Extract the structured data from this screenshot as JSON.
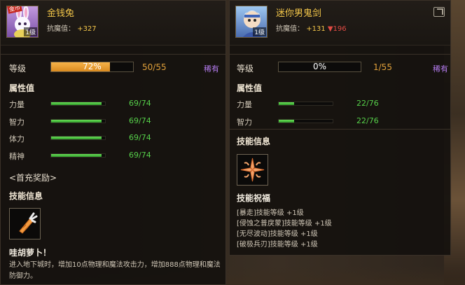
{
  "left": {
    "name": "金钱兔",
    "badge": "金币",
    "level_badge": "1级",
    "resist_label": "抗魔值：",
    "resist_plus": "+327",
    "level_label": "等级",
    "level_percent": "72%",
    "level_fill": 0.72,
    "level_count": "50/55",
    "rarity": "稀有",
    "attrs_title": "属性值",
    "attrs": [
      {
        "name": "力量",
        "value": "69/74",
        "ratio": 0.93
      },
      {
        "name": "智力",
        "value": "69/74",
        "ratio": 0.93
      },
      {
        "name": "体力",
        "value": "69/74",
        "ratio": 0.93
      },
      {
        "name": "精神",
        "value": "69/74",
        "ratio": 0.93
      }
    ],
    "first_charge": "<首充奖励>",
    "skills_title": "技能信息",
    "skill_name": "哇胡萝卜！",
    "skill_desc": "进入地下城时，增加10点物理和魔法攻击力，增加888点物理和魔法防御力。"
  },
  "right": {
    "name": "迷你男鬼剑",
    "level_badge": "1级",
    "resist_label": "抗魔值：",
    "resist_plus": "+131",
    "resist_down": "▼196",
    "level_label": "等级",
    "level_percent": "0%",
    "level_fill": 0.0,
    "level_count": "1/55",
    "rarity": "稀有",
    "attrs_title": "属性值",
    "attrs": [
      {
        "name": "力量",
        "value": "22/76",
        "ratio": 0.29
      },
      {
        "name": "智力",
        "value": "22/76",
        "ratio": 0.29
      }
    ],
    "skills_title": "技能信息",
    "skill_name": "技能祝福",
    "bonuses": [
      "[暴走]技能等级 +1级",
      "[侵蚀之普戾蒙]技能等级 +1级",
      "[无尽波动]技能等级 +1级",
      "[破极兵刃]技能等级 +1级"
    ]
  },
  "colors": {
    "gold": "#f3c64a",
    "green": "#56d04a",
    "purple": "#b57cf0",
    "red": "#e14b44"
  }
}
